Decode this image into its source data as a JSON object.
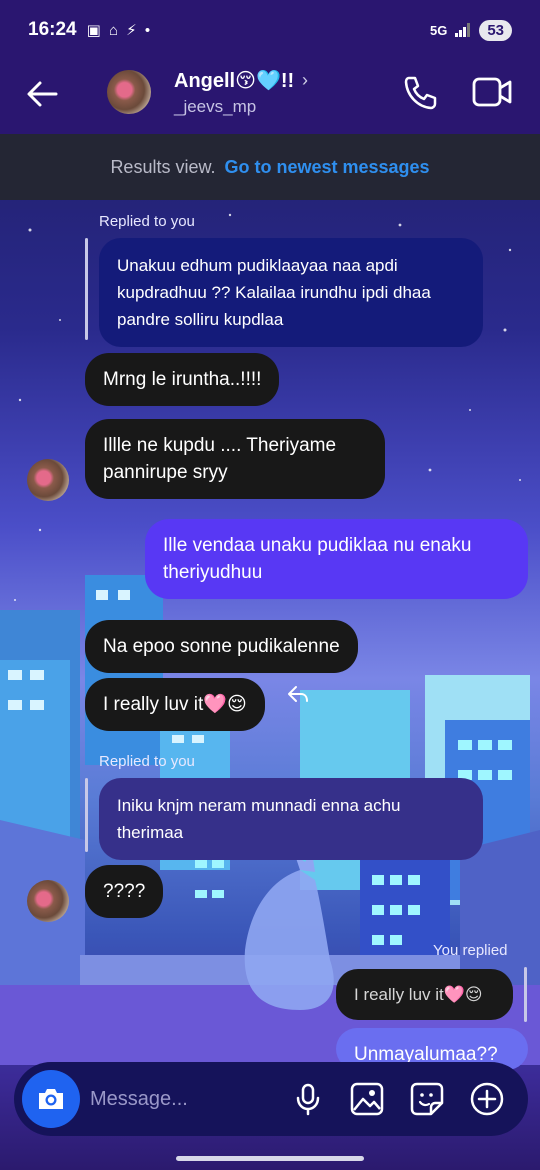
{
  "status_bar": {
    "time": "16:24",
    "indicators": "▣ ⌂ ⚡ •",
    "network": "5G",
    "battery": "53"
  },
  "header": {
    "contact_name": "Angell😚🩵!!",
    "username": "_jeevs_mp",
    "chevron": "›"
  },
  "banner": {
    "text": "Results view.",
    "link": "Go to newest messages"
  },
  "messages": [
    {
      "type": "reply_label",
      "text": "Replied to you"
    },
    {
      "type": "quote",
      "text": "Unakuu edhum pudiklaayaa naa apdi kupdradhuu ?? Kalailaa irundhu ipdi dhaa pandre solliru kupdlaa"
    },
    {
      "type": "received",
      "text": "Mrng le iruntha..!!!!"
    },
    {
      "type": "received",
      "text": "Illle ne kupdu .... Theriyame pannirupe sryy"
    },
    {
      "type": "sent",
      "text": "Ille vendaa unaku pudiklaa nu enaku theriyudhuu"
    },
    {
      "type": "received",
      "text": "Na epoo sonne pudikalenne"
    },
    {
      "type": "received",
      "text": "I really luv it🩷😌"
    },
    {
      "type": "reply_label",
      "text": "Replied to you"
    },
    {
      "type": "quote",
      "text": "Iniku knjm neram munnadi enna achu therimaa"
    },
    {
      "type": "received",
      "text": "????"
    },
    {
      "type": "reply_label_sent",
      "text": "You replied"
    },
    {
      "type": "sent_quote",
      "text": "I really luv it🩷😌"
    },
    {
      "type": "sent_partial",
      "text": "Unmayalumaa??"
    }
  ],
  "composer": {
    "placeholder": "Message..."
  },
  "icons": [
    "back-arrow-icon",
    "phone-icon",
    "video-camera-icon",
    "camera-icon",
    "microphone-icon",
    "gallery-icon",
    "sticker-icon",
    "plus-circle-icon",
    "reply-arrow-icon"
  ],
  "colors": {
    "header_bg": "#2a1670",
    "link_blue": "#2f8fef",
    "sent_bubble": "#5838f4",
    "received_bubble": "#181818",
    "quote_bubble": "#141b7a",
    "camera_button": "#1f63f0"
  }
}
